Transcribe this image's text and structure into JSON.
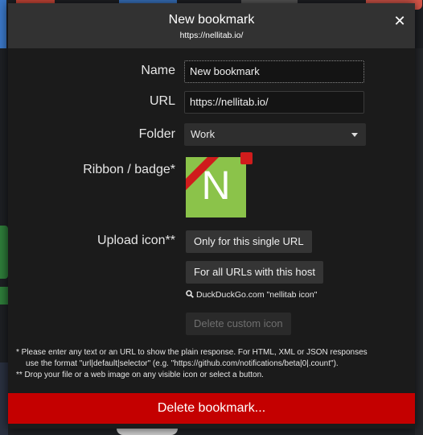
{
  "dialog": {
    "title": "New bookmark",
    "subtitle": "https://nellitab.io/",
    "close_glyph": "✕"
  },
  "form": {
    "name_label": "Name",
    "name_value": "New bookmark",
    "url_label": "URL",
    "url_value": "https://nellitab.io/",
    "folder_label": "Folder",
    "folder_value": "Work",
    "ribbon_label": "Ribbon / badge*",
    "badge_letter": "N",
    "badge_color": "#8bc34a",
    "ribbon_color": "#d01c1c",
    "upload_label": "Upload icon**",
    "btn_single": "Only for this single URL",
    "btn_host": "For all URLs with this host",
    "search_link": "DuckDuckGo.com \"nellitab icon\"",
    "btn_delete_icon": "Delete custom icon"
  },
  "notes": {
    "line1": "* Please enter any text or an URL to show the plain response. For HTML, XML or JSON responses",
    "line2": "use the format \"url|default|selector\" (e.g. \"https://github.com/notifications/beta|0|.count\").",
    "line3": "** Drop your file or a web image on any visible icon or select a button."
  },
  "footer": {
    "delete_label": "Delete bookmark...",
    "delete_color": "#c40000"
  }
}
